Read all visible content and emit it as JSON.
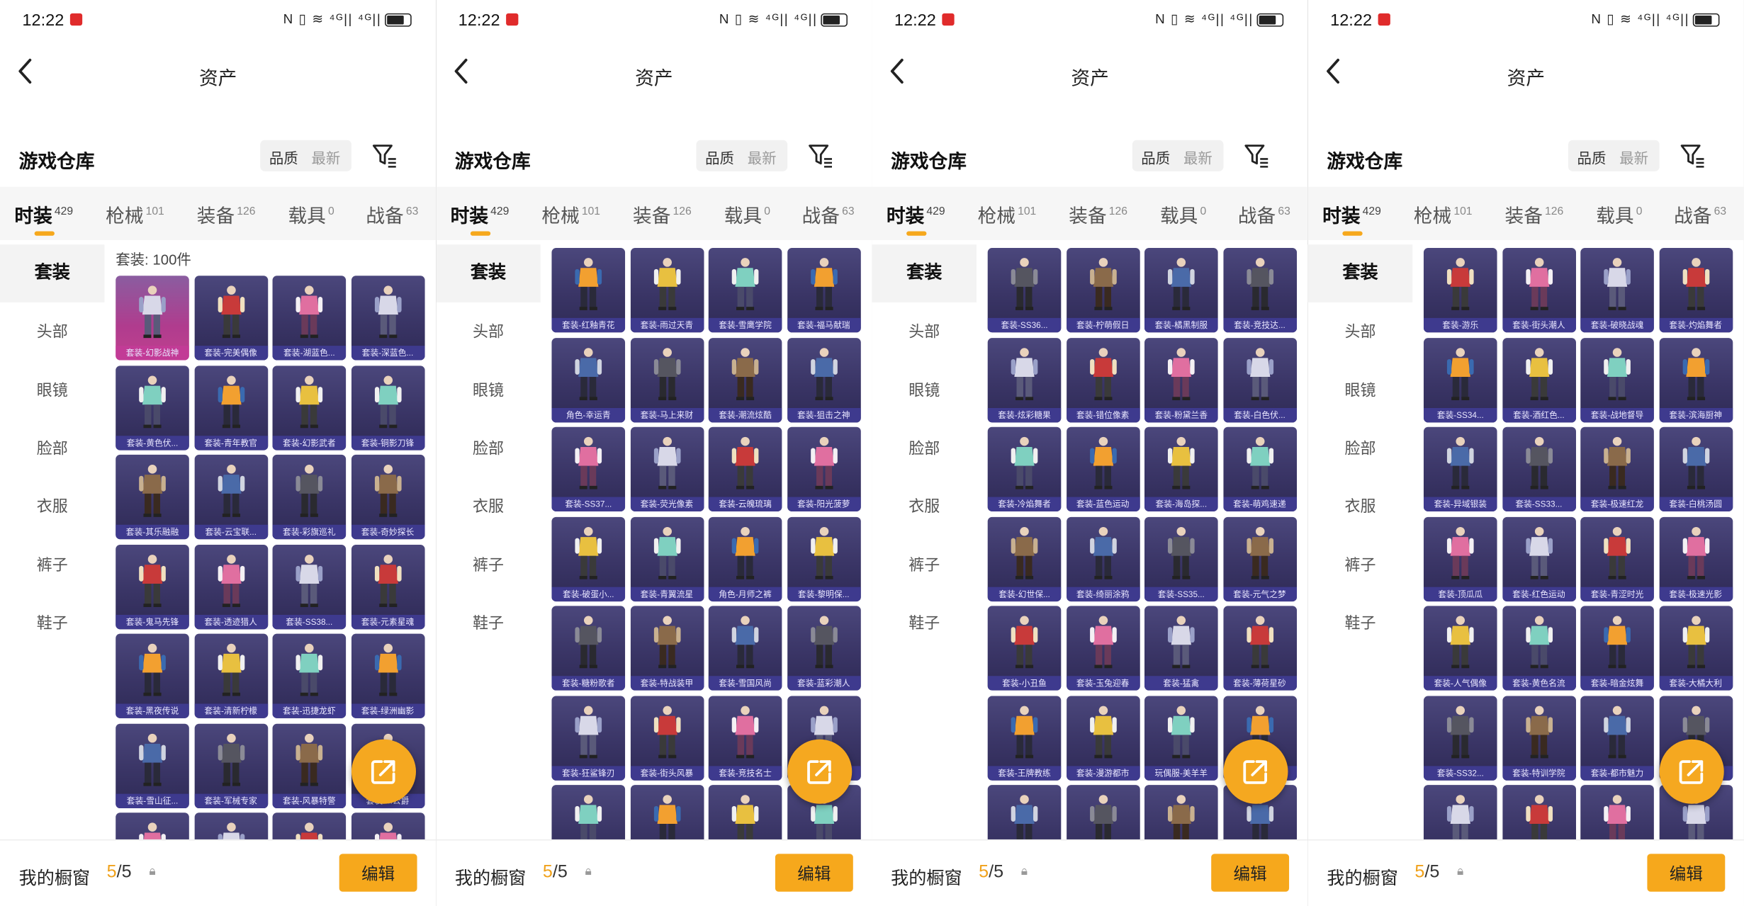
{
  "status_bar": {
    "time": "12:22",
    "icons": "N ▯ ≋ ⁴ᴳ|| ⁴ᴳ||"
  },
  "app_bar": {
    "title": "资产"
  },
  "section": {
    "title": "游戏仓库",
    "sort_quality": "品质",
    "sort_newest": "最新"
  },
  "tabs": [
    {
      "label": "时装",
      "count": "429"
    },
    {
      "label": "枪械",
      "count": "101"
    },
    {
      "label": "装备",
      "count": "126"
    },
    {
      "label": "载具",
      "count": "0"
    },
    {
      "label": "战备",
      "count": "63"
    }
  ],
  "sidebar": [
    "套装",
    "头部",
    "眼镜",
    "脸部",
    "衣服",
    "裤子",
    "鞋子"
  ],
  "grid_count_label": "套装: 100件",
  "bottom_bar": {
    "label": "我的橱窗",
    "count_current": "5",
    "count_sep": "/5",
    "edit_label": "编辑"
  },
  "colors": {
    "accent": "#f6a81c",
    "card_bg": "#3a3566",
    "card_caption": "#3e3a8e",
    "selected_card": "#c0408e"
  },
  "icons": {
    "back": "chevron-left-icon",
    "filter": "filter-icon",
    "share": "share-icon",
    "lock": "lock-icon"
  },
  "screens": [
    {
      "show_count": true,
      "items": [
        "套装-幻影战神",
        "套装-完美偶像",
        "套装-湖蓝色...",
        "套装-深蓝色...",
        "套装-黄色伏...",
        "套装-青年教官",
        "套装-幻影武者",
        "套装-铜影刀锋",
        "套装-其乐融融",
        "套装-云宝联...",
        "套装-彩旗巡礼",
        "套装-奇妙探长",
        "套装-鬼马先锋",
        "套装-透迹猎人",
        "套装-SS38...",
        "套装-元素星魂",
        "套装-黑夜传说",
        "套装-清新柠檬",
        "套装-迅捷龙虾",
        "套装-绿洲幽影",
        "套装-雪山征...",
        "套装-军械专家",
        "套装-风暴特警",
        "套装-...公爵",
        "",
        "",
        "",
        ""
      ]
    },
    {
      "show_count": false,
      "items": [
        "套装-红釉青花",
        "套装-雨过天青",
        "套装-雪鹰学院",
        "套装-福马献瑞",
        "角色-幸运青",
        "套装-马上来财",
        "套装-潮流炫酷",
        "套装-狙击之神",
        "套装-SS37...",
        "套装-荧光像素",
        "套装-云魄琉璃",
        "套装-阳光菠萝",
        "套装-破蛋小...",
        "套装-青翼流星",
        "角色-月师之裤",
        "套装-黎明保...",
        "套装-糖粉歌者",
        "套装-特战装甲",
        "套装-雪国风尚",
        "套装-蓝彩潮人",
        "套装-狂鲨锋刃",
        "套装-街头风暴",
        "套装-竞技名士",
        "套装-...",
        "",
        "",
        "",
        ""
      ]
    },
    {
      "show_count": false,
      "items": [
        "套装-SS36...",
        "套装-柠萌假日",
        "套装-橘黑制服",
        "套装-竞技达...",
        "套装-炫彩糖果",
        "套装-错位像素",
        "套装-粉黛兰香",
        "套装-白色伏...",
        "套装-冷焰舞者",
        "套装-蓝色运动",
        "套装-海岛探...",
        "套装-萌鸡速递",
        "套装-幻世保...",
        "套装-绮丽涂鸦",
        "套装-SS35...",
        "套装-元气之梦",
        "套装-小丑鱼",
        "套装-玉兔迎春",
        "套装-猛禽",
        "套装-薄荷星砂",
        "套装-王牌教练",
        "套装-漫游都市",
        "玩偶服-美羊羊",
        "套装-...",
        "",
        "",
        "",
        ""
      ]
    },
    {
      "show_count": false,
      "items": [
        "套装-游乐",
        "套装-街头潮人",
        "套装-破晓战魂",
        "套装-灼焰舞者",
        "套装-SS34...",
        "套装-酒红色...",
        "套装-战地督导",
        "套装-滨海厨神",
        "套装-异域银装",
        "套装-SS33...",
        "套装-极速红龙",
        "套装-白桃汤圆",
        "套装-顶瓜瓜",
        "套装-红色运动",
        "套装-青涩时光",
        "套装-极速光影",
        "套装-人气偶像",
        "套装-黄色名流",
        "套装-暗金炫舞",
        "套装-大橘大利",
        "套装-SS32...",
        "套装-特训学院",
        "套装-都市魅力",
        "套装-...",
        "",
        "",
        "",
        ""
      ]
    }
  ]
}
